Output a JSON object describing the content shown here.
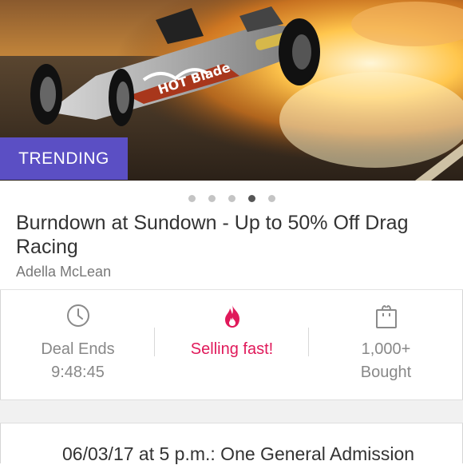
{
  "hero": {
    "badge": "TRENDING",
    "car_lettering": "HOT Blade",
    "carousel_count": 5,
    "carousel_active_index": 3
  },
  "deal": {
    "title": "Burndown at Sundown - Up to 50% Off Drag Racing",
    "merchant": "Adella McLean"
  },
  "stats": {
    "deal_ends_label": "Deal Ends",
    "deal_ends_time": "9:48:45",
    "selling_fast": "Selling fast!",
    "bought_count": "1,000+",
    "bought_label": "Bought"
  },
  "option": {
    "text": "06/03/17 at 5 p.m.: One General Admission"
  },
  "colors": {
    "badge_bg": "#5b4fc4",
    "selling_fast": "#e0195a",
    "muted_text": "#888888"
  },
  "icons": [
    "clock-icon",
    "flame-icon",
    "gift-bag-icon"
  ]
}
